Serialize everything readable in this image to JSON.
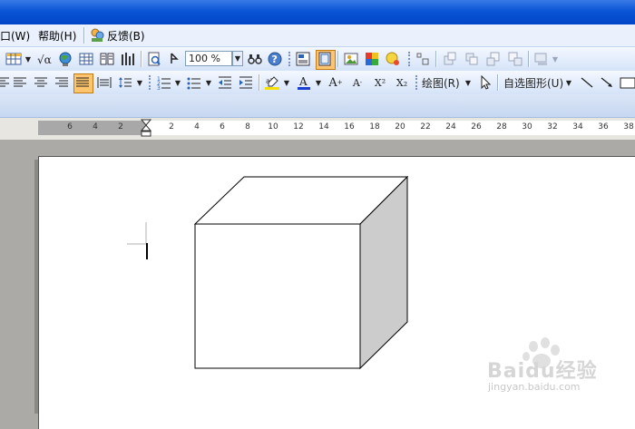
{
  "menubar": {
    "items": [
      {
        "label": "口(W)"
      },
      {
        "label": "帮助(H)"
      },
      {
        "label": "反馈(B)"
      }
    ]
  },
  "toolbar1": {
    "zoom": "100 %"
  },
  "toolbar2": {
    "font_grow": "A",
    "font_shrink": "A",
    "superscript": "X²",
    "subscript": "X₂",
    "draw_menu": "绘图(R)",
    "autoshapes_menu": "自选图形(U)"
  },
  "ruler": {
    "left_numbers": [
      "6",
      "4",
      "2"
    ],
    "right_numbers": [
      "2",
      "4",
      "6",
      "8",
      "10",
      "12",
      "14",
      "16",
      "18",
      "20",
      "22",
      "24",
      "26",
      "28",
      "30",
      "32",
      "34",
      "36",
      "38"
    ]
  },
  "watermark": {
    "logo_text": "Baidu经验",
    "url": "jingyan.baidu.com"
  },
  "colors": {
    "title_blue": "#0a55d6",
    "toolbar_bg": "#dce7f8",
    "highlight": "#ffc56e",
    "cube_side": "#cccccc"
  }
}
